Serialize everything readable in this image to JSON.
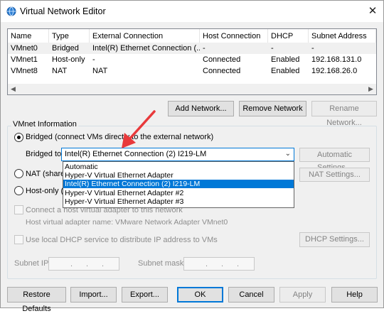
{
  "window": {
    "title": "Virtual Network Editor",
    "close_glyph": "✕"
  },
  "table": {
    "columns": [
      "Name",
      "Type",
      "External Connection",
      "Host Connection",
      "DHCP",
      "Subnet Address"
    ],
    "rows": [
      [
        "VMnet0",
        "Bridged",
        "Intel(R) Ethernet Connection (...",
        "-",
        "-",
        "-"
      ],
      [
        "VMnet1",
        "Host-only",
        "-",
        "Connected",
        "Enabled",
        "192.168.131.0"
      ],
      [
        "VMnet8",
        "NAT",
        "NAT",
        "Connected",
        "Enabled",
        "192.168.26.0"
      ]
    ]
  },
  "buttons": {
    "add_network": "Add Network...",
    "remove_network": "Remove Network",
    "rename_network": "Rename Network...",
    "automatic_settings": "Automatic Settings...",
    "nat_settings": "NAT Settings...",
    "dhcp_settings": "DHCP Settings...",
    "restore_defaults": "Restore Defaults",
    "import": "Import...",
    "export": "Export...",
    "ok": "OK",
    "cancel": "Cancel",
    "apply": "Apply",
    "help": "Help"
  },
  "vmnet_info": {
    "group_label": "VMnet Information",
    "bridged_label": "Bridged (connect VMs directly to the external network)",
    "bridged_to_label": "Bridged to:",
    "bridged_to_value": "Intel(R) Ethernet Connection (2) I219-LM",
    "nat_label": "NAT (shared",
    "host_only_label": "Host-only (c",
    "connect_host_adapter": "Connect a host virtual adapter to this network",
    "host_adapter_name": "Host virtual adapter name: VMware Network Adapter VMnet0",
    "use_dhcp": "Use local DHCP service to distribute IP address to VMs",
    "subnet_ip_label": "Subnet IP:",
    "subnet_mask_label": "Subnet mask:",
    "ip_dots": "."
  },
  "dropdown": {
    "options": [
      "Automatic",
      "Hyper-V Virtual Ethernet Adapter",
      "Intel(R) Ethernet Connection (2) I219-LM",
      "Hyper-V Virtual Ethernet Adapter #2",
      "Hyper-V Virtual Ethernet Adapter #3"
    ],
    "selected_index": 2
  },
  "colors": {
    "accent": "#0078d7",
    "annotation_arrow": "#e8393b"
  }
}
